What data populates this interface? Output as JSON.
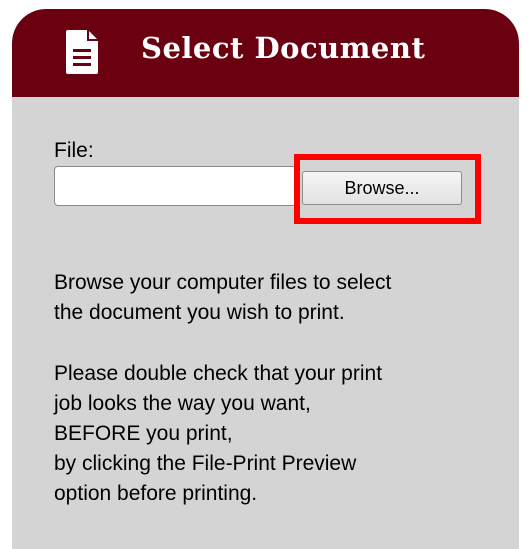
{
  "header": {
    "title": "Select Document",
    "icon": "document-icon",
    "background_color": "#6b0011"
  },
  "file_field": {
    "label": "File:",
    "value": ""
  },
  "browse_button": {
    "label": "Browse..."
  },
  "highlight": {
    "color": "#ff0000"
  },
  "instructions": {
    "paragraph_1": [
      "Browse your computer files to select",
      "the document you wish to print."
    ],
    "paragraph_2": [
      "Please double check that your print",
      "job looks the way you want,",
      "BEFORE you print,",
      "by clicking the File-Print Preview",
      "option before printing."
    ]
  }
}
